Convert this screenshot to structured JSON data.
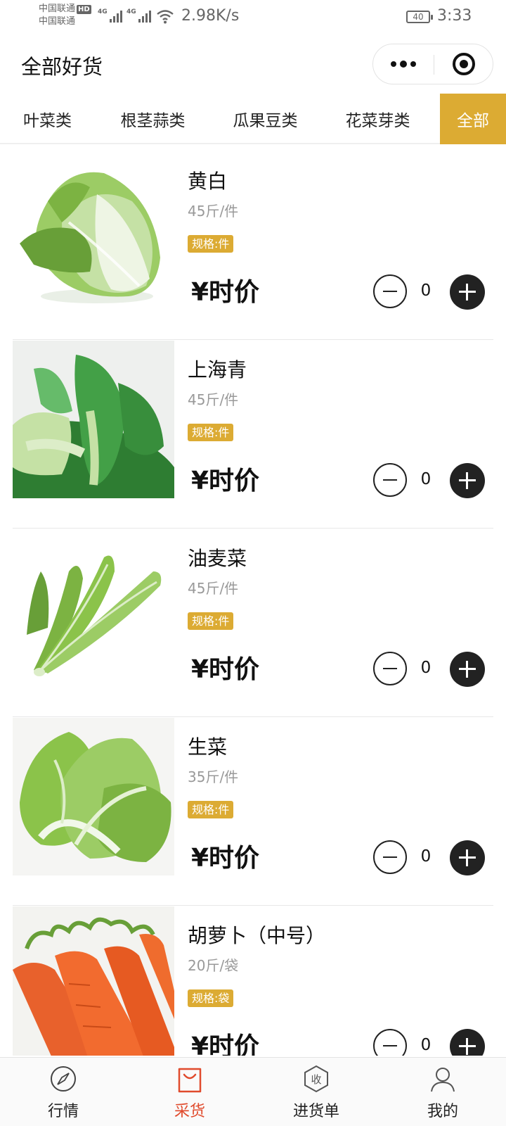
{
  "status_bar": {
    "carrier_1": "中国联通",
    "carrier_1_badge": "HD",
    "carrier_2": "中国联通",
    "network_1": "4G",
    "network_2": "4G",
    "speed": "2.98K/s",
    "battery": "40",
    "time": "3:33"
  },
  "header": {
    "title": "全部好货",
    "more_icon": "more-dots-icon",
    "close_icon": "target-close-icon"
  },
  "categories": [
    {
      "label": "叶菜类",
      "active": false
    },
    {
      "label": "根茎蒜类",
      "active": false
    },
    {
      "label": "瓜果豆类",
      "active": false
    },
    {
      "label": "花菜芽类",
      "active": false
    },
    {
      "label": "全部",
      "active": true
    }
  ],
  "products": [
    {
      "name": "黄白",
      "weight": "45斤/件",
      "spec": "规格:件",
      "price": "¥时价",
      "qty": "0",
      "image": "napa-cabbage"
    },
    {
      "name": "上海青",
      "weight": "45斤/件",
      "spec": "规格:件",
      "price": "¥时价",
      "qty": "0",
      "image": "bok-choy"
    },
    {
      "name": "油麦菜",
      "weight": "45斤/件",
      "spec": "规格:件",
      "price": "¥时价",
      "qty": "0",
      "image": "leaf-lettuce"
    },
    {
      "name": "生菜",
      "weight": "35斤/件",
      "spec": "规格:件",
      "price": "¥时价",
      "qty": "0",
      "image": "romaine-lettuce"
    },
    {
      "name": "胡萝卜（中号）",
      "weight": "20斤/袋",
      "spec": "规格:袋",
      "price": "¥时价",
      "qty": "0",
      "image": "carrots"
    }
  ],
  "tabbar": [
    {
      "label": "行情",
      "icon": "compass-icon",
      "active": false
    },
    {
      "label": "采货",
      "icon": "shopping-bag-icon",
      "active": true
    },
    {
      "label": "进货单",
      "icon": "receive-hexagon-icon",
      "active": false
    },
    {
      "label": "我的",
      "icon": "user-icon",
      "active": false
    }
  ],
  "colors": {
    "accent": "#dcab33",
    "active_tab_text": "#e04b2d",
    "dark": "#222222"
  }
}
